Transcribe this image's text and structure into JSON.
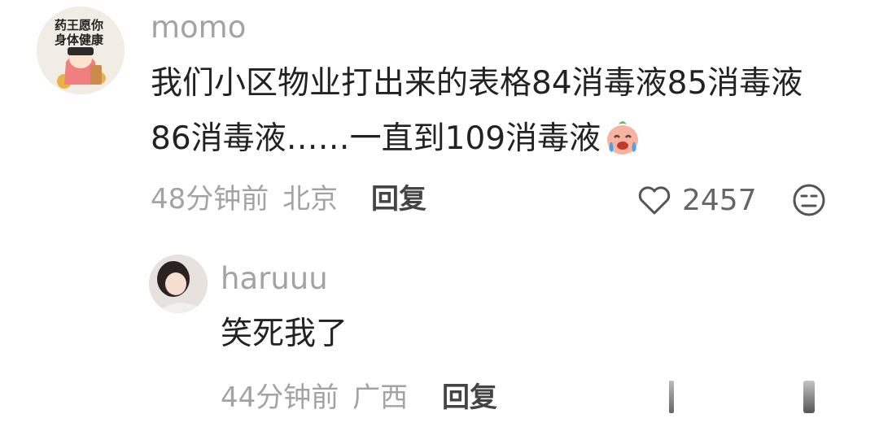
{
  "comment": {
    "avatar_text_line1": "药王愿你",
    "avatar_text_line2": "身体健康",
    "username": "momo",
    "text_line1": "我们小区物业打出来的表格84消毒液85消毒液",
    "text_line2": "86消毒液……一直到109消毒液",
    "time": "48分钟前",
    "location": "北京",
    "reply_label": "回复",
    "like_count": "2457"
  },
  "reply": {
    "username": "haruuu",
    "text": "笑死我了",
    "time": "44分钟前",
    "location": "广西",
    "reply_label": "回复"
  },
  "colors": {
    "meta": "#a3a3a3",
    "text": "#222222",
    "icon": "#555555"
  }
}
